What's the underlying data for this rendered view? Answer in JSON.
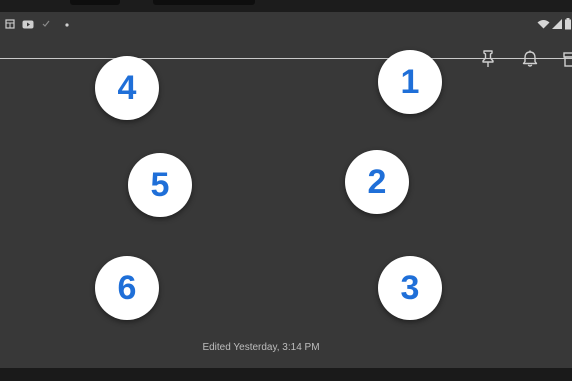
{
  "status_bar": {
    "icons": [
      "app-icon",
      "youtube-icon",
      "check-icon",
      "dot-icon",
      "wifi-icon",
      "signal-icon",
      "battery-icon"
    ]
  },
  "toolbar": {
    "icons": [
      "pin-icon",
      "reminder-bell-icon",
      "archive-icon"
    ]
  },
  "badges": [
    {
      "label": "4"
    },
    {
      "label": "1"
    },
    {
      "label": "5"
    },
    {
      "label": "2"
    },
    {
      "label": "6"
    },
    {
      "label": "3"
    }
  ],
  "footer": {
    "edited_text": "Edited Yesterday, 3:14 PM"
  },
  "colors": {
    "screen_bg": "#383838",
    "badge_bg": "#ffffff",
    "badge_text": "#1f6fd8",
    "divider": "#c9c9c9"
  }
}
